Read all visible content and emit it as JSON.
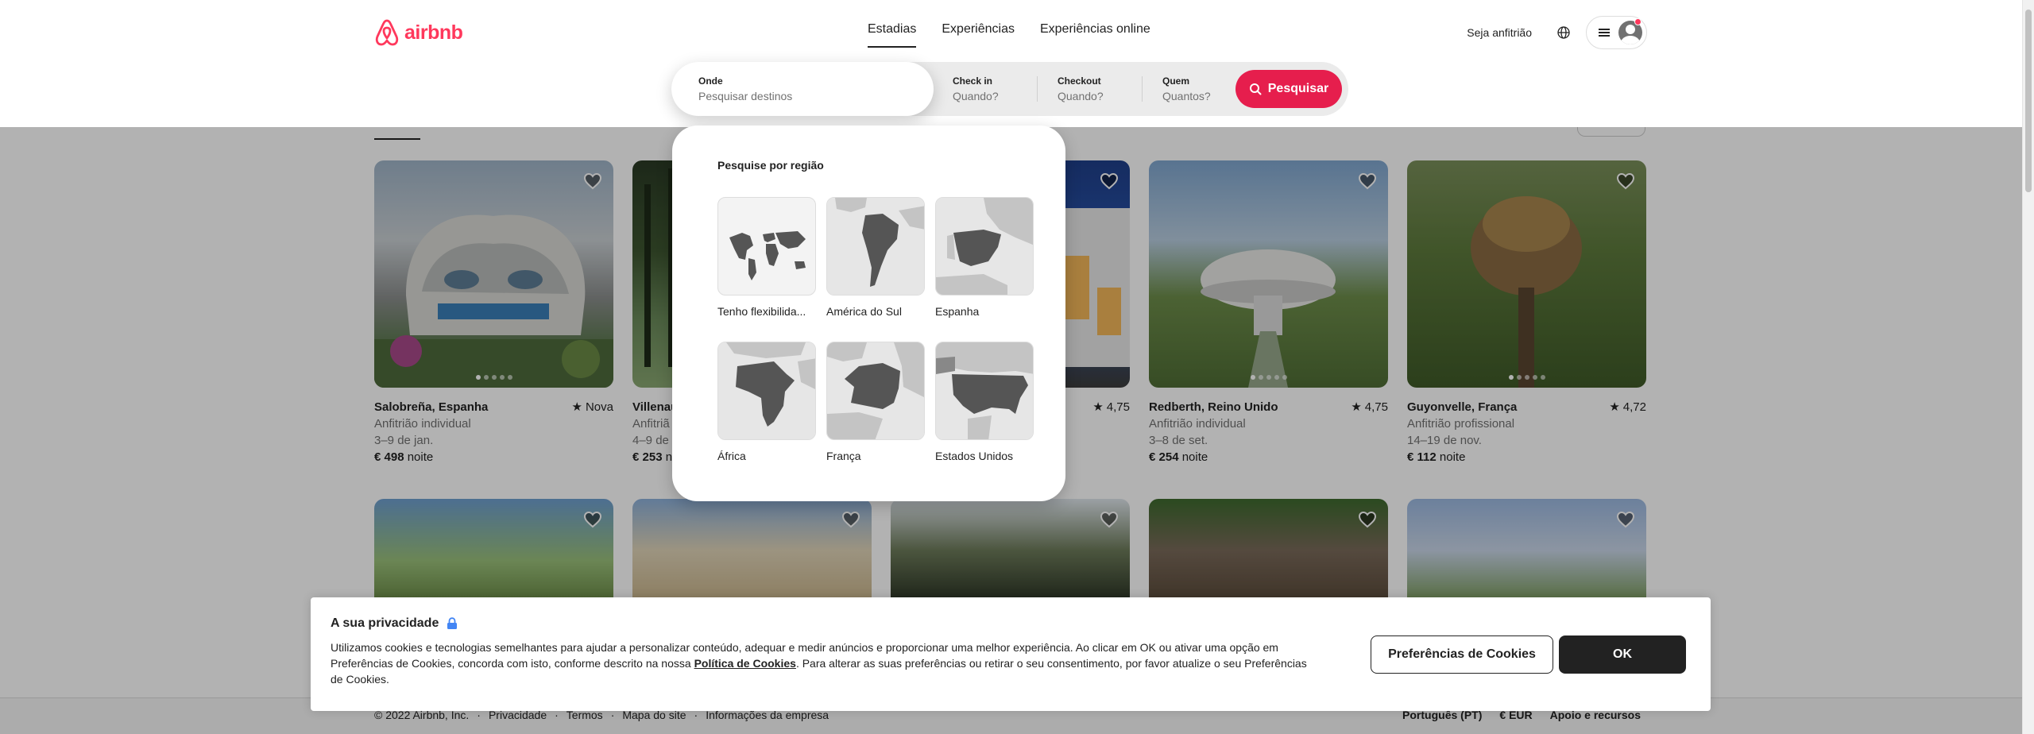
{
  "brand": {
    "name": "airbnb",
    "color": "#ff385c"
  },
  "nav": {
    "tabs": [
      {
        "label": "Estadias",
        "active": true
      },
      {
        "label": "Experiências",
        "active": false
      },
      {
        "label": "Experiências online",
        "active": false
      }
    ],
    "host_label": "Seja anfitrião",
    "globe_icon": "globe-icon",
    "menu_icon": "menu-icon"
  },
  "search": {
    "where_label": "Onde",
    "where_placeholder": "Pesquisar destinos",
    "checkin_label": "Check in",
    "checkin_value": "Quando?",
    "checkout_label": "Checkout",
    "checkout_value": "Quando?",
    "who_label": "Quem",
    "who_value": "Quantos?",
    "button_label": "Pesquisar",
    "button_color": "#e61e4d"
  },
  "region_panel": {
    "title": "Pesquise por região",
    "regions": [
      {
        "label": "Tenho flexibilida..."
      },
      {
        "label": "América do Sul"
      },
      {
        "label": "Espanha"
      },
      {
        "label": "África"
      },
      {
        "label": "França"
      },
      {
        "label": "Estados Unidos"
      }
    ]
  },
  "listings": [
    {
      "title": "Salobreña, Espanha",
      "rating": "Nova",
      "host": "Anfitrião individual",
      "dates": "3–9 de jan.",
      "price": "€ 498",
      "price_unit": "noite"
    },
    {
      "title": "Villenau",
      "rating": "",
      "host": "Anfitriã",
      "dates": "4–9 de",
      "price": "€ 253",
      "price_unit": "no"
    },
    {
      "title": "",
      "rating": "4,75",
      "host": "",
      "dates": "",
      "price": "",
      "price_unit": ""
    },
    {
      "title": "Redberth, Reino Unido",
      "rating": "4,75",
      "host": "Anfitrião individual",
      "dates": "3–8 de set.",
      "price": "€ 254",
      "price_unit": "noite"
    },
    {
      "title": "Guyonvelle, França",
      "rating": "4,72",
      "host": "Anfitrião profissional",
      "dates": "14–19 de nov.",
      "price": "€ 112",
      "price_unit": "noite"
    }
  ],
  "cookie": {
    "title": "A sua privacidade",
    "text_before": "Utilizamos cookies e tecnologias semelhantes para ajudar a personalizar conteúdo, adequar e medir anúncios e proporcionar uma melhor experiência. Ao clicar em OK ou ativar uma opção em Preferências de Cookies, concorda com isto, conforme descrito na nossa ",
    "link": "Política de Cookies",
    "text_after": ". Para alterar as suas preferências ou retirar o seu consentimento, por favor atualize o seu Preferências de Cookies.",
    "prefs_button": "Preferências de Cookies",
    "ok_button": "OK"
  },
  "footer": {
    "left": [
      "© 2022 Airbnb, Inc.",
      "·",
      "Privacidade",
      "·",
      "Termos",
      "·",
      "Mapa do site",
      "·",
      "Informações da empresa"
    ],
    "language": "Português (PT)",
    "currency": "€  EUR",
    "support": "Apoio e recursos"
  }
}
